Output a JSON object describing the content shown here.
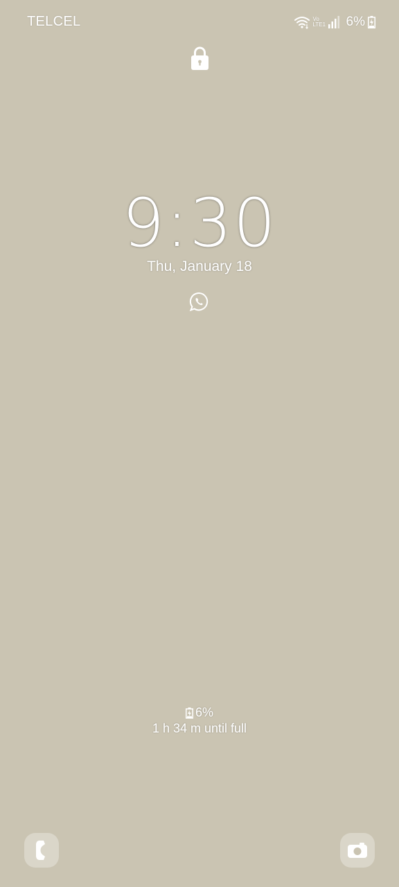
{
  "status_bar": {
    "carrier": "TELCEL",
    "volte_top": "Vo",
    "volte_bottom": "LTE1",
    "battery_percent": "6%",
    "icons": [
      "wifi-icon",
      "volte-icon",
      "signal-icon",
      "battery-charging-icon"
    ]
  },
  "lock": {
    "icon": "lock-icon"
  },
  "clock": {
    "time": "9:30",
    "date": "Thu, January 18"
  },
  "notifications": {
    "icons": [
      "whatsapp-icon"
    ]
  },
  "charging": {
    "percent": "6%",
    "time_until_full": "1 h 34 m until full"
  },
  "shortcuts": {
    "left": "phone-icon",
    "right": "camera-icon"
  },
  "colors": {
    "background": "#cac4b2",
    "foreground": "#ffffff"
  }
}
